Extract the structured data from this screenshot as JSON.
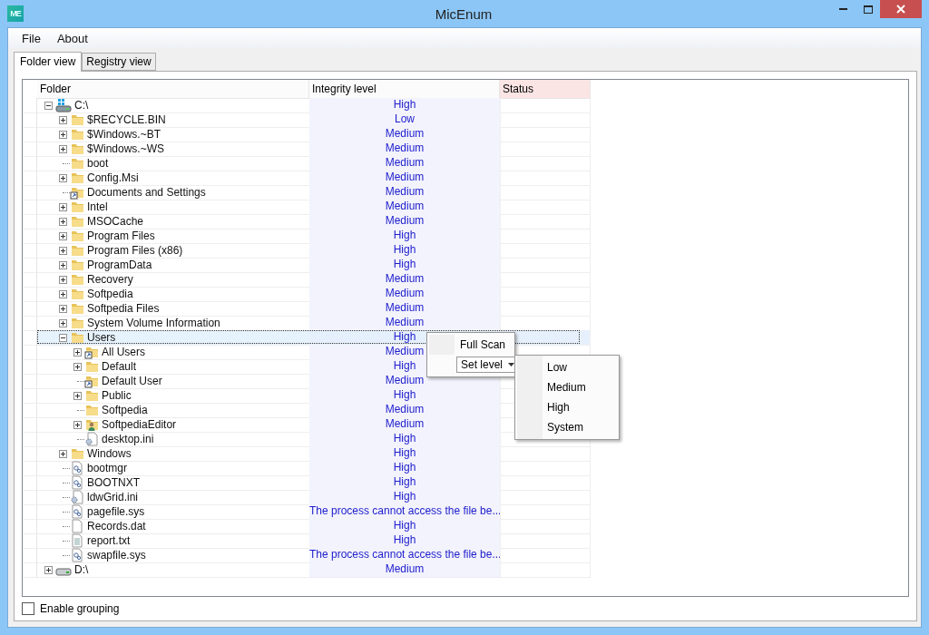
{
  "window": {
    "title": "MicEnum",
    "logo": "ME"
  },
  "menu": [
    "File",
    "About"
  ],
  "tabs": [
    {
      "label": "Folder view",
      "selected": true
    },
    {
      "label": "Registry view",
      "selected": false
    }
  ],
  "table": {
    "columns": [
      "Folder",
      "Integrity level",
      "Status"
    ],
    "rows": [
      {
        "name": "C:\\",
        "kind": "windows-drive",
        "level": "High",
        "expanded": true,
        "selected": false,
        "children": [
          {
            "name": "$RECYCLE.BIN",
            "kind": "folder",
            "level": "Low",
            "expanded": false,
            "selected": false
          },
          {
            "name": "$Windows.~BT",
            "kind": "folder",
            "level": "Medium",
            "expanded": false,
            "selected": false
          },
          {
            "name": "$Windows.~WS",
            "kind": "folder",
            "level": "Medium",
            "expanded": false,
            "selected": false
          },
          {
            "name": "boot",
            "kind": "folder",
            "level": "Medium",
            "selected": false
          },
          {
            "name": "Config.Msi",
            "kind": "folder",
            "level": "Medium",
            "expanded": false,
            "selected": false
          },
          {
            "name": "Documents and Settings",
            "kind": "shortcut",
            "level": "Medium",
            "selected": false
          },
          {
            "name": "Intel",
            "kind": "folder",
            "level": "Medium",
            "expanded": false,
            "selected": false
          },
          {
            "name": "MSOCache",
            "kind": "folder",
            "level": "Medium",
            "expanded": false,
            "selected": false
          },
          {
            "name": "Program Files",
            "kind": "folder",
            "level": "High",
            "expanded": false,
            "selected": false
          },
          {
            "name": "Program Files (x86)",
            "kind": "folder",
            "level": "High",
            "expanded": false,
            "selected": false
          },
          {
            "name": "ProgramData",
            "kind": "folder",
            "level": "High",
            "expanded": false,
            "selected": false
          },
          {
            "name": "Recovery",
            "kind": "folder",
            "level": "Medium",
            "expanded": false,
            "selected": false
          },
          {
            "name": "Softpedia",
            "kind": "folder",
            "level": "Medium",
            "expanded": false,
            "selected": false
          },
          {
            "name": "Softpedia Files",
            "kind": "folder",
            "level": "Medium",
            "expanded": false,
            "selected": false
          },
          {
            "name": "System Volume Information",
            "kind": "folder",
            "level": "Medium",
            "expanded": false,
            "selected": false
          },
          {
            "name": "Users",
            "kind": "folder",
            "level": "High",
            "expanded": true,
            "selected": true,
            "children": [
              {
                "name": "All Users",
                "kind": "shortcut",
                "level": "Medium",
                "expanded": false,
                "selected": false
              },
              {
                "name": "Default",
                "kind": "folder",
                "level": "High",
                "expanded": false,
                "selected": false
              },
              {
                "name": "Default User",
                "kind": "shortcut",
                "level": "Medium",
                "selected": false
              },
              {
                "name": "Public",
                "kind": "folder",
                "level": "High",
                "expanded": false,
                "selected": false
              },
              {
                "name": "Softpedia",
                "kind": "folder",
                "level": "Medium",
                "selected": false
              },
              {
                "name": "SoftpediaEditor",
                "kind": "user",
                "level": "Medium",
                "expanded": false,
                "selected": false
              },
              {
                "name": "desktop.ini",
                "kind": "settings-file",
                "level": "High",
                "selected": false
              }
            ]
          },
          {
            "name": "Windows",
            "kind": "folder",
            "level": "High",
            "expanded": false,
            "selected": false
          },
          {
            "name": "bootmgr",
            "kind": "system-file",
            "level": "High",
            "selected": false
          },
          {
            "name": "BOOTNXT",
            "kind": "system-file",
            "level": "High",
            "selected": false
          },
          {
            "name": "ldwGrid.ini",
            "kind": "settings-file",
            "level": "High",
            "selected": false
          },
          {
            "name": "pagefile.sys",
            "kind": "system-file",
            "level": "The process cannot access the file be...",
            "selected": false
          },
          {
            "name": "Records.dat",
            "kind": "file",
            "level": "High",
            "selected": false
          },
          {
            "name": "report.txt",
            "kind": "text-file",
            "level": "High",
            "selected": false
          },
          {
            "name": "swapfile.sys",
            "kind": "system-file",
            "level": "The process cannot access the file be...",
            "selected": false
          }
        ]
      },
      {
        "name": "D:\\",
        "kind": "drive",
        "level": "Medium",
        "expanded": false,
        "selected": false
      }
    ]
  },
  "context_menu": {
    "items": [
      {
        "label": "Full Scan",
        "kind": "item"
      },
      {
        "label": "Set level",
        "kind": "dropdown"
      }
    ],
    "submenu": [
      "Low",
      "Medium",
      "High",
      "System"
    ]
  },
  "grouping": {
    "label": "Enable grouping",
    "checked": false
  }
}
